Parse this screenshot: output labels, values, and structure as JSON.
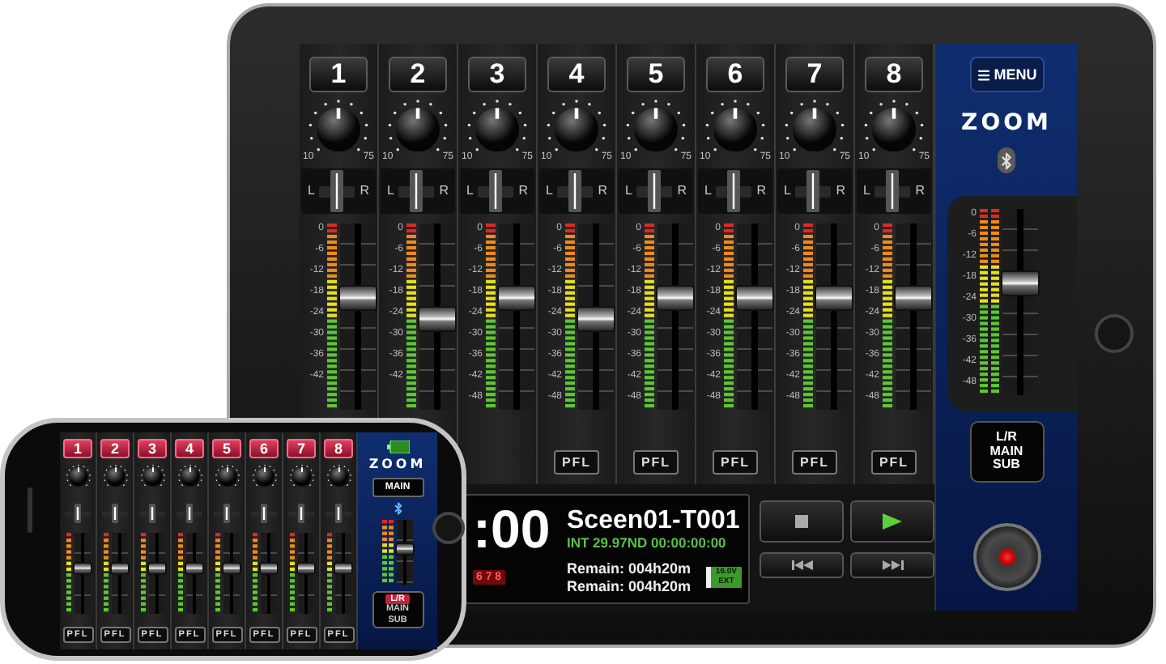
{
  "tablet": {
    "channels": [
      {
        "number": "1",
        "knob_min": "10",
        "knob_max": "75",
        "pan_left": "L",
        "pan_right": "R",
        "pan": {
          "level": 0.5
        },
        "scale": [
          "0",
          "-6",
          "-12",
          "-18",
          "-24",
          "-30",
          "-36",
          "-42"
        ],
        "level": 0.625
      },
      {
        "number": "2",
        "knob_min": "10",
        "knob_max": "75",
        "pan_left": "L",
        "pan_right": "R",
        "pan": {
          "level": 0.5
        },
        "scale": [
          "0",
          "-6",
          "-12",
          "-18",
          "-24",
          "-30",
          "-36",
          "-42"
        ],
        "level": 0.5
      },
      {
        "number": "3",
        "knob_min": "10",
        "knob_max": "75",
        "pan_left": "L",
        "pan_right": "R",
        "pan": {
          "level": 0.5
        },
        "scale": [
          "0",
          "-6",
          "-12",
          "-18",
          "-24",
          "-30",
          "-36",
          "-42",
          "-48"
        ],
        "level": 0.625
      },
      {
        "number": "4",
        "knob_min": "10",
        "knob_max": "75",
        "pan_left": "L",
        "pan_right": "R",
        "pan": {
          "level": 0.5
        },
        "scale": [
          "0",
          "-6",
          "-12",
          "-18",
          "-24",
          "-30",
          "-36",
          "-42",
          "-48"
        ],
        "level": 0.5,
        "pfl": "PFL"
      },
      {
        "number": "5",
        "knob_min": "10",
        "knob_max": "75",
        "pan_left": "L",
        "pan_right": "R",
        "pan": {
          "level": 0.5
        },
        "scale": [
          "0",
          "-6",
          "-12",
          "-18",
          "-24",
          "-30",
          "-36",
          "-42",
          "-48"
        ],
        "level": 0.625,
        "pfl": "PFL"
      },
      {
        "number": "6",
        "knob_min": "10",
        "knob_max": "75",
        "pan_left": "L",
        "pan_right": "R",
        "pan": {
          "level": 0.5
        },
        "scale": [
          "0",
          "-6",
          "-12",
          "-18",
          "-24",
          "-30",
          "-36",
          "-42",
          "-48"
        ],
        "level": 0.625,
        "pfl": "PFL"
      },
      {
        "number": "7",
        "knob_min": "10",
        "knob_max": "75",
        "pan_left": "L",
        "pan_right": "R",
        "pan": {
          "level": 0.5
        },
        "scale": [
          "0",
          "-6",
          "-12",
          "-18",
          "-24",
          "-30",
          "-36",
          "-42",
          "-48"
        ],
        "level": 0.625,
        "pfl": "PFL"
      },
      {
        "number": "8",
        "knob_min": "10",
        "knob_max": "75",
        "pan_left": "L",
        "pan_right": "R",
        "pan": {
          "level": 0.5
        },
        "scale": [
          "0",
          "-6",
          "-12",
          "-18",
          "-24",
          "-30",
          "-36",
          "-42",
          "-48"
        ],
        "level": 0.625,
        "pfl": "PFL"
      }
    ],
    "master": {
      "menu": "MENU",
      "logo": "ZOOM",
      "scale": [
        "0",
        "-6",
        "-12",
        "-18",
        "-24",
        "-30",
        "-36",
        "-42",
        "-48"
      ],
      "level": 0.625,
      "bus_button": [
        "L/R",
        "MAIN",
        "SUB"
      ]
    },
    "display": {
      "time": ":00",
      "take": "Sceen01-T001",
      "timecode": "INT 29.97ND 00:00:00:00",
      "tracks": "6 7 8",
      "remain": [
        "Remain: 004h20m",
        "Remain: 004h20m"
      ],
      "battery": [
        "16.0V",
        "EXT"
      ]
    },
    "transport": [
      {
        "kind": "stop"
      },
      {
        "kind": "play"
      },
      {
        "kind": "rewind"
      },
      {
        "kind": "fast_forward"
      }
    ]
  },
  "phone": {
    "channels": [
      {
        "number": "1",
        "selected": true,
        "pan": {
          "level": 0.5
        },
        "level": 0.6,
        "pfl": "PFL"
      },
      {
        "number": "2",
        "selected": true,
        "pan": {
          "level": 0.5
        },
        "level": 0.6,
        "pfl": "PFL"
      },
      {
        "number": "3",
        "selected": true,
        "pan": {
          "level": 0.5
        },
        "level": 0.6,
        "pfl": "PFL"
      },
      {
        "number": "4",
        "selected": true,
        "pan": {
          "level": 0.5
        },
        "level": 0.6,
        "pfl": "PFL"
      },
      {
        "number": "5",
        "selected": true,
        "pan": {
          "level": 0.5
        },
        "level": 0.6,
        "pfl": "PFL"
      },
      {
        "number": "6",
        "selected": true,
        "pan": {
          "level": 0.5
        },
        "level": 0.6,
        "pfl": "PFL"
      },
      {
        "number": "7",
        "selected": true,
        "pan": {
          "level": 0.5
        },
        "level": 0.6,
        "pfl": "PFL"
      },
      {
        "number": "8",
        "selected": true,
        "pan": {
          "level": 0.5
        },
        "level": 0.6,
        "pfl": "PFL"
      }
    ],
    "logo": "ZOOM",
    "output_button": "MAIN",
    "level": 0.6,
    "bus": [
      {
        "label": "L/R",
        "selected": true
      },
      {
        "label": "MAIN",
        "selected": false
      },
      {
        "label": "SUB",
        "selected": false
      }
    ]
  }
}
